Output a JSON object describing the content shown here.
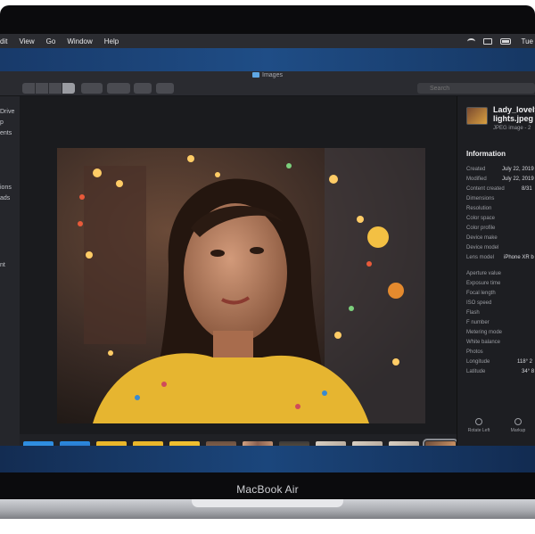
{
  "menubar": {
    "items": [
      "dit",
      "View",
      "Go",
      "Window",
      "Help"
    ],
    "clock": "Tue"
  },
  "window": {
    "title": "Images",
    "search_placeholder": "Search"
  },
  "sidebar": {
    "items": [
      "Drive",
      "p",
      "ents",
      "ions",
      "ads",
      "nt"
    ]
  },
  "inspector": {
    "file_name_line1": "Lady_lovely",
    "file_name_line2": "lights.jpeg",
    "file_kind": "JPEG image - 2",
    "section_title": "Information",
    "rows": [
      {
        "label": "Created",
        "value": "July 22, 2019"
      },
      {
        "label": "Modified",
        "value": "July 22, 2019"
      },
      {
        "label": "Content created",
        "value": "8/31"
      },
      {
        "label": "Dimensions",
        "value": ""
      },
      {
        "label": "Resolution",
        "value": ""
      },
      {
        "label": "Color space",
        "value": ""
      },
      {
        "label": "Color profile",
        "value": ""
      },
      {
        "label": "Device make",
        "value": ""
      },
      {
        "label": "Device model",
        "value": ""
      },
      {
        "label": "Lens model",
        "value": "iPhone XR b"
      },
      {
        "label": "Aperture value",
        "value": ""
      },
      {
        "label": "Exposure time",
        "value": ""
      },
      {
        "label": "Focal length",
        "value": ""
      },
      {
        "label": "ISO speed",
        "value": ""
      },
      {
        "label": "Flash",
        "value": ""
      },
      {
        "label": "F number",
        "value": ""
      },
      {
        "label": "Metering mode",
        "value": ""
      },
      {
        "label": "White balance",
        "value": ""
      },
      {
        "label": "Photos",
        "value": ""
      },
      {
        "label": "Longitude",
        "value": "118° 2"
      },
      {
        "label": "Latitude",
        "value": "34° 8"
      }
    ],
    "actions": {
      "rotate": "Rotate Left",
      "markup": "Markup"
    }
  },
  "device": {
    "brand": "MacBook Air"
  },
  "colors": {
    "accent": "#5fa7e5",
    "window_bg": "#202125",
    "desktop": "#1f4d86"
  },
  "icons": [
    "wifi-icon",
    "display-icon",
    "battery-icon",
    "folder-icon",
    "search-icon",
    "rotate-left-icon",
    "markup-icon"
  ]
}
